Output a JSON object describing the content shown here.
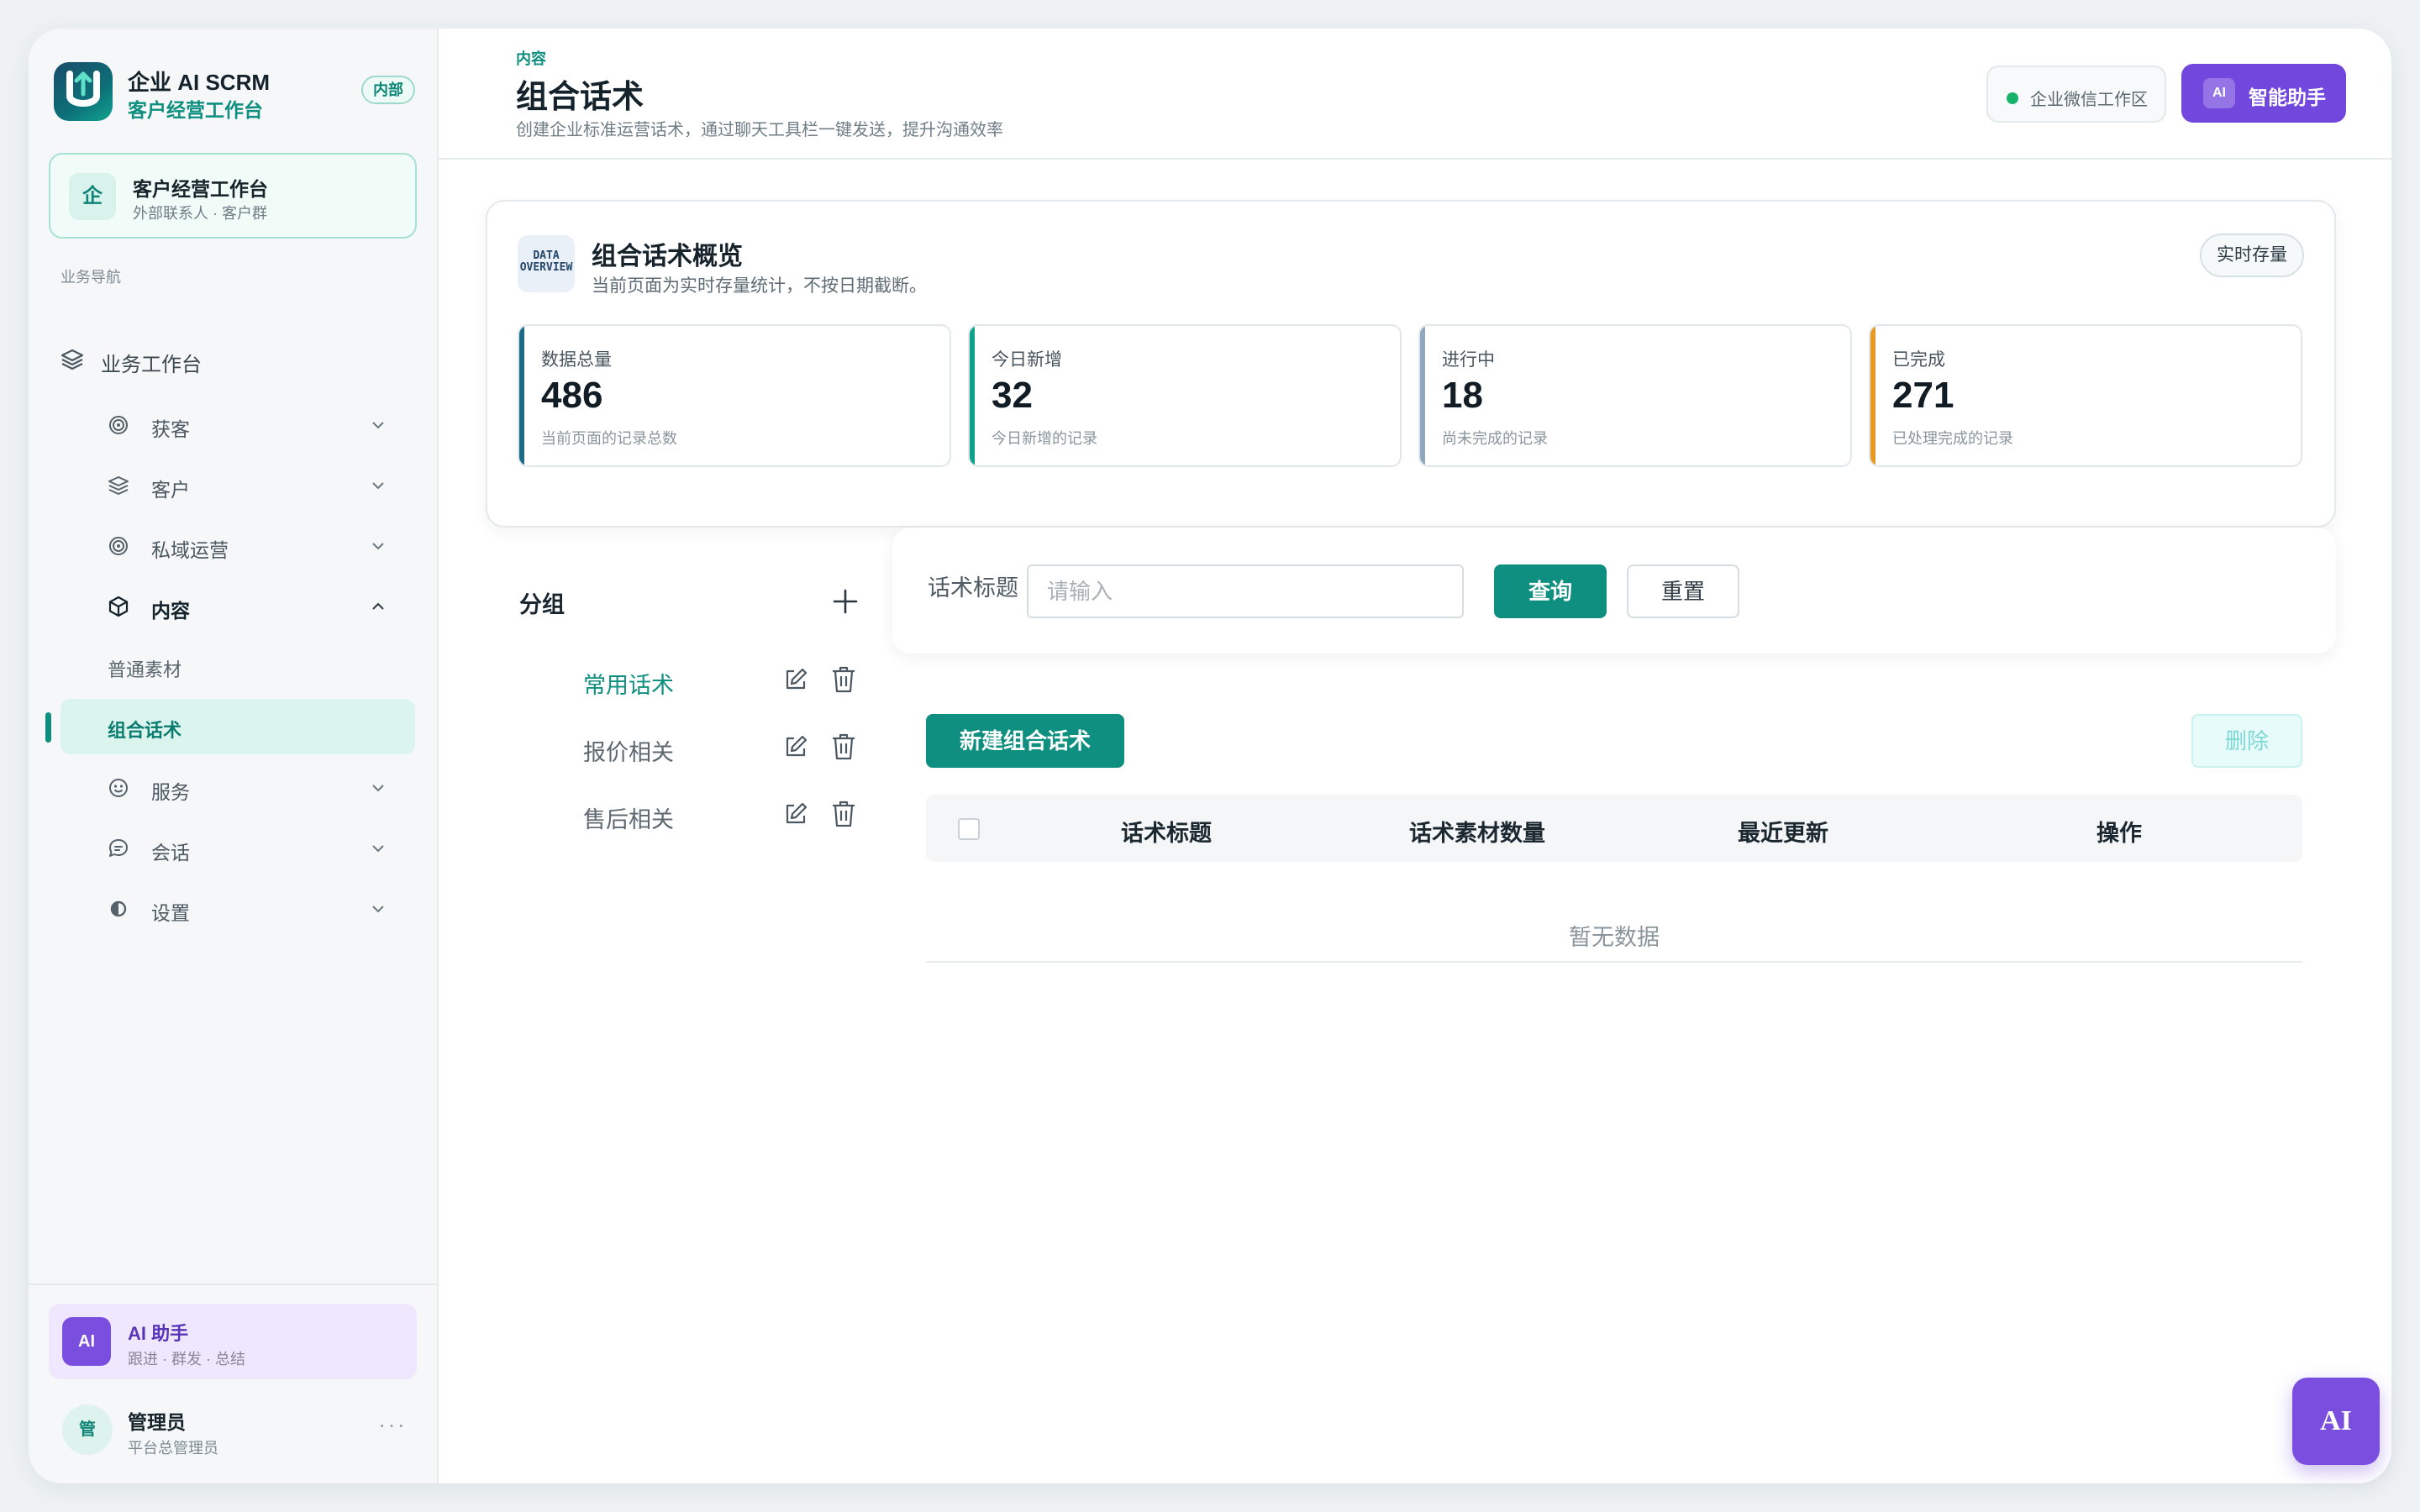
{
  "brand": {
    "title": "企业 AI SCRM",
    "subtitle": "客户经营工作台",
    "badge": "内部"
  },
  "workspace": {
    "icon_text": "企",
    "title": "客户经营工作台",
    "subtitle": "外部联系人 · 客户群"
  },
  "nav": {
    "section_label": "业务导航",
    "top_item": "业务工作台",
    "items": [
      {
        "label": "获客",
        "icon": "target-icon"
      },
      {
        "label": "客户",
        "icon": "layers-icon"
      },
      {
        "label": "私域运营",
        "icon": "target-icon"
      },
      {
        "label": "内容",
        "icon": "cube-icon"
      },
      {
        "label": "服务",
        "icon": "smile-icon"
      },
      {
        "label": "会话",
        "icon": "chat-icon"
      },
      {
        "label": "设置",
        "icon": "settings-icon"
      }
    ],
    "content_children": [
      "普通素材",
      "组合话术"
    ],
    "active": "组合话术"
  },
  "sidebar_bottom": {
    "ai": {
      "avatar": "AI",
      "title": "AI 助手",
      "subtitle": "跟进 · 群发 · 总结"
    },
    "user": {
      "avatar": "管",
      "name": "管理员",
      "role": "平台总管理员",
      "more": "···"
    }
  },
  "header": {
    "breadcrumb": "内容",
    "title": "组合话术",
    "description": "创建企业标准运营话术，通过聊天工具栏一键发送，提升沟通效率",
    "env_label": "企业微信工作区",
    "env_status_color": "#18b36b",
    "ai_button_badge": "AI",
    "ai_button_label": "智能助手"
  },
  "overview": {
    "icon_text_1": "DATA",
    "icon_text_2": "OVERVIEW",
    "title": "组合话术概览",
    "subtitle": "当前页面为实时存量统计，不按日期截断。",
    "tag": "实时存量",
    "stats": [
      {
        "label": "数据总量",
        "value": "486",
        "note": "当前页面的记录总数",
        "color": "#1b6b86"
      },
      {
        "label": "今日新增",
        "value": "32",
        "note": "今日新增的记录",
        "color": "#11a08c"
      },
      {
        "label": "进行中",
        "value": "18",
        "note": "尚未完成的记录",
        "color": "#8fa6bd"
      },
      {
        "label": "已完成",
        "value": "271",
        "note": "已处理完成的记录",
        "color": "#e69a24"
      }
    ]
  },
  "groups": {
    "title": "分组",
    "items": [
      {
        "label": "常用话术",
        "active": true
      },
      {
        "label": "报价相关",
        "active": false
      },
      {
        "label": "售后相关",
        "active": false
      }
    ]
  },
  "search": {
    "label": "话术标题",
    "placeholder": "请输入",
    "value": "",
    "query_label": "查询",
    "reset_label": "重置"
  },
  "table": {
    "new_label": "新建组合话术",
    "delete_label": "删除",
    "columns": [
      "话术标题",
      "话术素材数量",
      "最近更新",
      "操作"
    ],
    "empty_text": "暂无数据"
  },
  "fab": {
    "label": "AI"
  },
  "colors": {
    "accent": "#0e8f80",
    "purple": "#7247de"
  }
}
